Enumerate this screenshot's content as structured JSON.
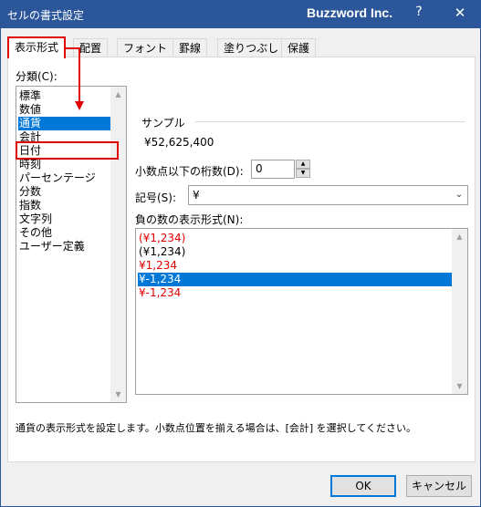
{
  "window": {
    "title": "セルの書式設定",
    "brand": "Buzzword Inc.",
    "help": "?",
    "close": "✕"
  },
  "tabs": [
    {
      "label": "表示形式",
      "active": true
    },
    {
      "label": "配置"
    },
    {
      "label": "フォント"
    },
    {
      "label": "罫線"
    },
    {
      "label": "塗りつぶし"
    },
    {
      "label": "保護"
    }
  ],
  "category": {
    "label": "分類(C):",
    "items": [
      "標準",
      "数値",
      "通貨",
      "会計",
      "日付",
      "時刻",
      "パーセンテージ",
      "分数",
      "指数",
      "文字列",
      "その他",
      "ユーザー定義"
    ],
    "selected": "通貨"
  },
  "sample": {
    "label": "サンプル",
    "value": "¥52,625,400"
  },
  "decimal": {
    "label": "小数点以下の桁数(D):",
    "value": "0"
  },
  "symbol": {
    "label": "記号(S):",
    "value": "¥"
  },
  "negative": {
    "label": "負の数の表示形式(N):",
    "items": [
      {
        "text": "(¥1,234)",
        "color": "#e00000"
      },
      {
        "text": "(¥1,234)",
        "color": "#000000"
      },
      {
        "text": "¥1,234",
        "color": "#e00000"
      },
      {
        "text": "¥-1,234",
        "color": "#000000",
        "selected": true
      },
      {
        "text": "¥-1,234",
        "color": "#e00000"
      }
    ]
  },
  "description": "通貨の表示形式を設定します。小数点位置を揃える場合は、[会計] を選択してください。",
  "buttons": {
    "ok": "OK",
    "cancel": "キャンセル"
  },
  "colors": {
    "titlebar": "#2b579a",
    "selection": "#0078d7",
    "highlight": "#e00000"
  }
}
